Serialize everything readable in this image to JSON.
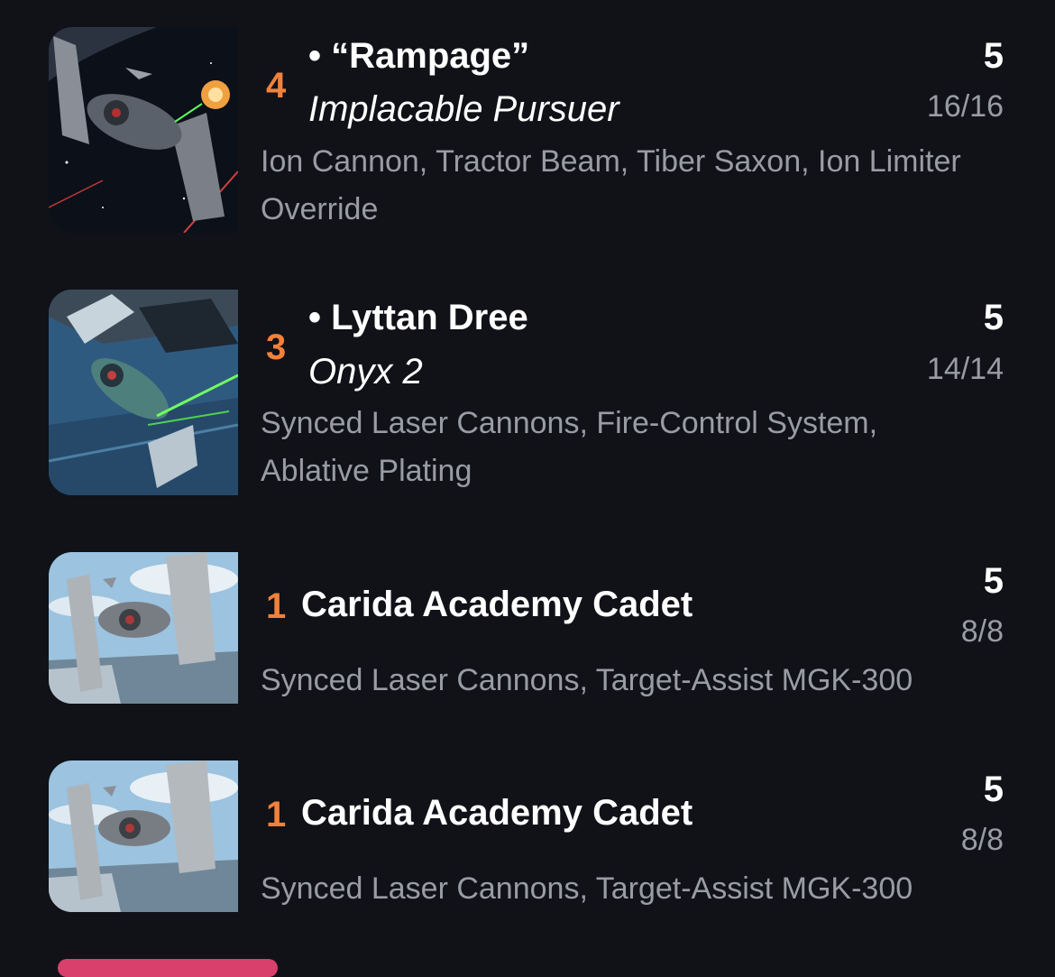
{
  "pilots": [
    {
      "initiative": "4",
      "name": "• “Rampage”",
      "subtitle": "Implacable Pursuer",
      "upgrades": "Ion Cannon, Tractor Beam, Tiber Saxon, Ion Limiter Override",
      "cost": "5",
      "hp": "16/16",
      "image": "tie-fighter-space-battle-art"
    },
    {
      "initiative": "3",
      "name": "• Lyttan Dree",
      "subtitle": "Onyx 2",
      "upgrades": "Synced Laser Cannons, Fire-Control System, Ablative Plating",
      "cost": "5",
      "hp": "14/14",
      "image": "tie-fighter-blue-hangar-art"
    },
    {
      "initiative": "1",
      "name": "Carida Academy Cadet",
      "subtitle": "",
      "upgrades": "Synced Laser Cannons, Target-Assist MGK-300",
      "cost": "5",
      "hp": "8/8",
      "image": "tie-fighter-sky-art"
    },
    {
      "initiative": "1",
      "name": "Carida Academy Cadet",
      "subtitle": "",
      "upgrades": "Synced Laser Cannons, Target-Assist MGK-300",
      "cost": "5",
      "hp": "8/8",
      "image": "tie-fighter-sky-art"
    }
  ],
  "colors": {
    "background": "#101218",
    "initiative": "#f2813a",
    "secondary_text": "#9a9ca3",
    "accent_tab": "#d9416c"
  }
}
